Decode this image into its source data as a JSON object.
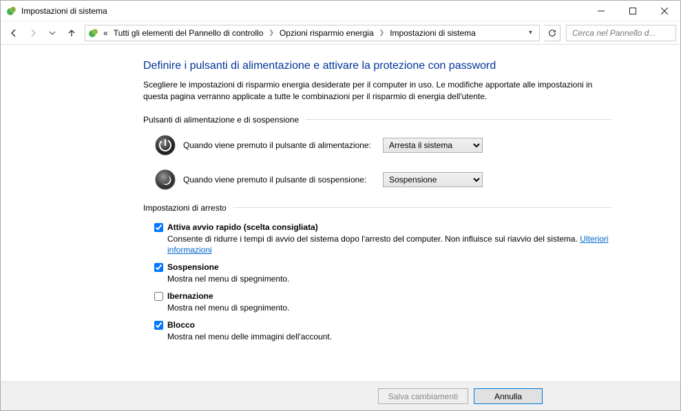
{
  "window": {
    "title": "Impostazioni di sistema"
  },
  "nav": {
    "back": "Indietro",
    "forward": "Avanti",
    "up": "Su"
  },
  "breadcrumb": {
    "prefix": "«",
    "items": [
      "Tutti gli elementi del Pannello di controllo",
      "Opzioni risparmio energia",
      "Impostazioni di sistema"
    ]
  },
  "search": {
    "placeholder": "Cerca nel Pannello d..."
  },
  "page": {
    "title": "Definire i pulsanti di alimentazione e attivare la protezione con password",
    "description": "Scegliere le impostazioni di risparmio energia desiderate per il computer in uso. Le modifiche apportate alle impostazioni in questa pagina verranno applicate a tutte le combinazioni per il risparmio di energia dell'utente."
  },
  "section1": {
    "header": "Pulsanti di alimentazione e di sospensione",
    "powerButton": {
      "label": "Quando viene premuto il pulsante di alimentazione:",
      "value": "Arresta il sistema"
    },
    "sleepButton": {
      "label": "Quando viene premuto il pulsante di sospensione:",
      "value": "Sospensione"
    }
  },
  "section2": {
    "header": "Impostazioni di arresto",
    "fastStartup": {
      "title": "Attiva avvio rapido (scelta consigliata)",
      "desc": "Consente di ridurre i tempi di avvio del sistema dopo l'arresto del computer. Non influisce sul riavvio del sistema. ",
      "link": "Ulteriori informazioni",
      "checked": true
    },
    "sleep": {
      "title": "Sospensione",
      "desc": "Mostra nel menu di spegnimento.",
      "checked": true
    },
    "hibernate": {
      "title": "Ibernazione",
      "desc": "Mostra nel menu di spegnimento.",
      "checked": false
    },
    "lock": {
      "title": "Blocco",
      "desc": "Mostra nel menu delle immagini dell'account.",
      "checked": true
    }
  },
  "footer": {
    "save": "Salva cambiamenti",
    "cancel": "Annulla"
  }
}
